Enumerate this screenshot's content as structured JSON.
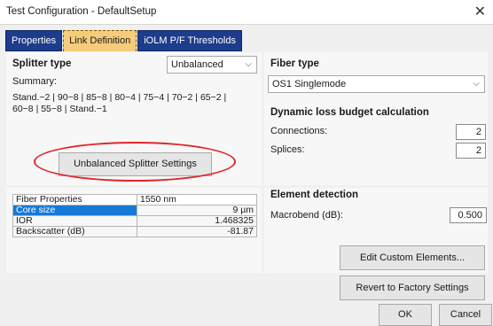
{
  "window": {
    "title": "Test Configuration - DefaultSetup",
    "close_glyph": "✕"
  },
  "tabs": [
    {
      "label": "Properties"
    },
    {
      "label": "Link Definition"
    },
    {
      "label": "iOLM P/F Thresholds"
    }
  ],
  "splitter": {
    "heading": "Splitter type",
    "type_value": "Unbalanced",
    "summary_label": "Summary:",
    "summary_text_line1": "Stand.−2 | 90−8 | 85−8 | 80−4 | 75−4 | 70−2 | 65−2 |",
    "summary_text_line2": "60−8 | 55−8 | Stand.−1",
    "settings_button": "Unbalanced Splitter Settings"
  },
  "fiber_properties": {
    "header_name": "Fiber Properties",
    "header_value": "1550 nm",
    "rows": [
      {
        "name": "Core size",
        "value": "9 µm"
      },
      {
        "name": "IOR",
        "value": "1.468325"
      },
      {
        "name": "Backscatter (dB)",
        "value": "-81.87"
      }
    ]
  },
  "fiber_type": {
    "heading": "Fiber type",
    "value": "OS1 Singlemode"
  },
  "loss_budget": {
    "heading": "Dynamic loss budget calculation",
    "connections_label": "Connections:",
    "connections_value": "2",
    "splices_label": "Splices:",
    "splices_value": "2"
  },
  "element_detection": {
    "heading": "Element detection",
    "macrobend_label": "Macrobend (dB):",
    "macrobend_value": "0.500"
  },
  "buttons": {
    "edit_custom": "Edit Custom Elements...",
    "revert": "Revert to Factory Settings",
    "ok": "OK",
    "cancel": "Cancel"
  },
  "colors": {
    "tab_bg": "#1e3c8c",
    "tab_active_bg": "#f6cc7a",
    "selection": "#1679d8",
    "highlight_ellipse": "#e0262b"
  }
}
